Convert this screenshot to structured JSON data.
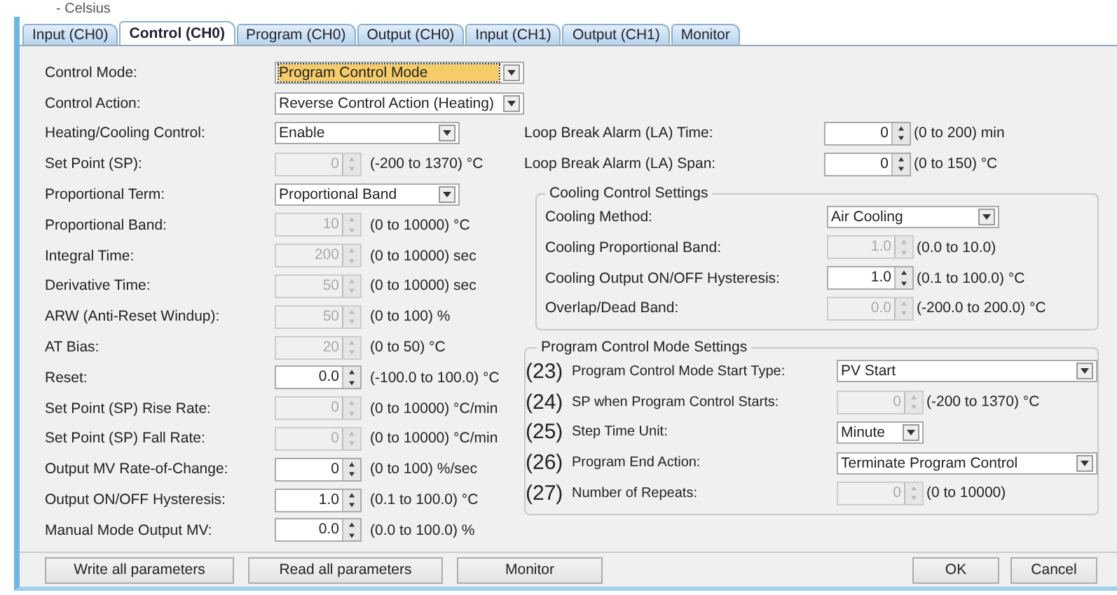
{
  "header_text": "- Celsius",
  "tabs": [
    {
      "label": "Input (CH0)",
      "selected": false
    },
    {
      "label": "Control (CH0)",
      "selected": true
    },
    {
      "label": "Program (CH0)",
      "selected": false
    },
    {
      "label": "Output (CH0)",
      "selected": false
    },
    {
      "label": "Input (CH1)",
      "selected": false
    },
    {
      "label": "Output (CH1)",
      "selected": false
    },
    {
      "label": "Monitor",
      "selected": false
    }
  ],
  "left_settings": [
    {
      "label": "Control Mode:",
      "kind": "dropdown",
      "value": "Program Control Mode",
      "focused": true
    },
    {
      "label": "Control Action:",
      "kind": "dropdown",
      "value": "Reverse Control Action (Heating)",
      "focused": false
    },
    {
      "label": "Heating/Cooling Control:",
      "kind": "dropdown",
      "value": "Enable",
      "focused": false
    },
    {
      "label": "Set Point (SP):",
      "kind": "spin",
      "value": "0",
      "disabled": true,
      "range": "(-200 to 1370) °C"
    },
    {
      "label": "Proportional Term:",
      "kind": "dropdown",
      "value": "Proportional Band",
      "focused": false
    },
    {
      "label": "Proportional Band:",
      "kind": "spin",
      "value": "10",
      "disabled": true,
      "range": "(0 to 10000) °C"
    },
    {
      "label": "Integral Time:",
      "kind": "spin",
      "value": "200",
      "disabled": true,
      "range": "(0 to 10000) sec"
    },
    {
      "label": "Derivative Time:",
      "kind": "spin",
      "value": "50",
      "disabled": true,
      "range": "(0 to 10000) sec"
    },
    {
      "label": "ARW (Anti-Reset Windup):",
      "kind": "spin",
      "value": "50",
      "disabled": true,
      "range": "(0 to 100) %"
    },
    {
      "label": "AT Bias:",
      "kind": "spin",
      "value": "20",
      "disabled": true,
      "range": "(0 to 50) °C"
    },
    {
      "label": "Reset:",
      "kind": "spin",
      "value": "0.0",
      "disabled": false,
      "range": "(-100.0 to 100.0) °C"
    },
    {
      "label": "Set Point (SP) Rise Rate:",
      "kind": "spin",
      "value": "0",
      "disabled": true,
      "range": "(0 to 10000) °C/min"
    },
    {
      "label": "Set Point (SP) Fall Rate:",
      "kind": "spin",
      "value": "0",
      "disabled": true,
      "range": "(0 to 10000) °C/min"
    },
    {
      "label": "Output MV Rate-of-Change:",
      "kind": "spin",
      "value": "0",
      "disabled": false,
      "range": "(0 to 100) %/sec"
    },
    {
      "label": "Output ON/OFF Hysteresis:",
      "kind": "spin",
      "value": "1.0",
      "disabled": false,
      "range": "(0.1 to 100.0) °C"
    },
    {
      "label": "Manual Mode Output MV:",
      "kind": "spin",
      "value": "0.0",
      "disabled": false,
      "range": "(0.0 to 100.0) %"
    }
  ],
  "right_settings": [
    {
      "label": "Loop Break Alarm (LA) Time:",
      "kind": "spin",
      "value": "0",
      "disabled": false,
      "range": "(0 to 200) min"
    },
    {
      "label": "Loop Break Alarm (LA) Span:",
      "kind": "spin",
      "value": "0",
      "disabled": false,
      "range": "(0 to 150) °C"
    }
  ],
  "cooling_group": {
    "title": "Cooling Control Settings",
    "settings": [
      {
        "label": "Cooling Method:",
        "kind": "dropdown",
        "value": "Air Cooling",
        "focused": false
      },
      {
        "label": "Cooling Proportional Band:",
        "kind": "spin",
        "value": "1.0",
        "disabled": true,
        "range": "(0.0 to 10.0)"
      },
      {
        "label": "Cooling Output ON/OFF Hysteresis:",
        "kind": "spin",
        "value": "1.0",
        "disabled": false,
        "range": "(0.1 to 100.0) °C"
      },
      {
        "label": "Overlap/Dead Band:",
        "kind": "spin",
        "value": "0.0",
        "disabled": true,
        "range": "(-200.0 to 200.0) °C"
      }
    ]
  },
  "program_group": {
    "title": "Program Control Mode Settings",
    "settings": [
      {
        "number": "(23)",
        "label": "Program Control Mode Start Type:",
        "kind": "dropdown",
        "value": "PV Start",
        "focused": false
      },
      {
        "number": "(24)",
        "label": "SP when Program Control Starts:",
        "kind": "spin",
        "value": "0",
        "disabled": true,
        "range": "(-200 to 1370) °C"
      },
      {
        "number": "(25)",
        "label": "Step Time Unit:",
        "kind": "dropdown",
        "value": "Minute",
        "focused": false
      },
      {
        "number": "(26)",
        "label": "Program End Action:",
        "kind": "dropdown",
        "value": "Terminate Program Control",
        "focused": false
      },
      {
        "number": "(27)",
        "label": "Number of Repeats:",
        "kind": "spin",
        "value": "0",
        "disabled": true,
        "range": "(0 to 10000)"
      }
    ]
  },
  "left_buttons": [
    "Write all parameters",
    "Read all parameters",
    "Monitor"
  ],
  "right_buttons": [
    "OK",
    "Cancel"
  ]
}
